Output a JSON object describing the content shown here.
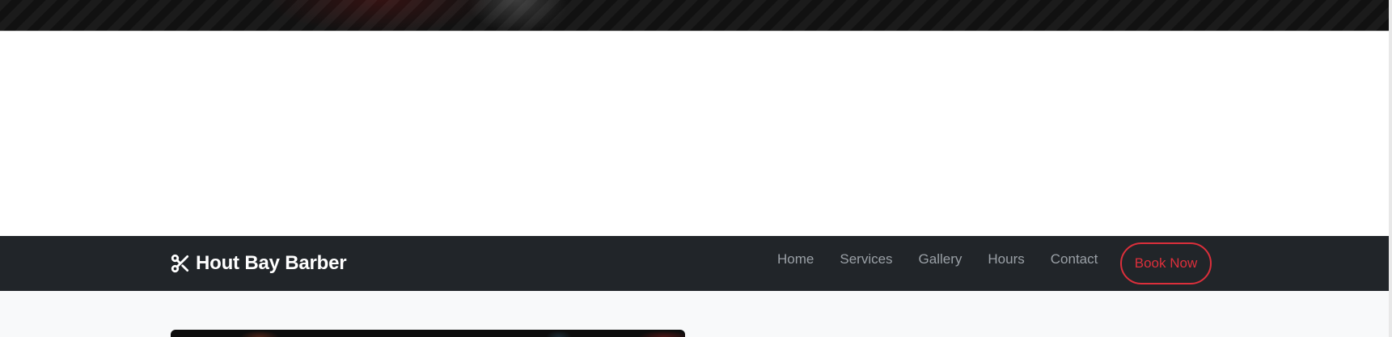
{
  "navbar": {
    "brand": {
      "icon": "scissors-icon",
      "name": "Hout Bay Barber"
    },
    "links": [
      {
        "label": "Home"
      },
      {
        "label": "Services"
      },
      {
        "label": "Gallery"
      },
      {
        "label": "Hours"
      },
      {
        "label": "Contact"
      }
    ],
    "cta_label": "Book Now"
  },
  "colors": {
    "navbar_bg": "#212529",
    "accent": "#dc2f3b",
    "nav_link": "#9aa0a6",
    "brand_text": "#ffffff",
    "content_bg": "#f8f9fa"
  }
}
